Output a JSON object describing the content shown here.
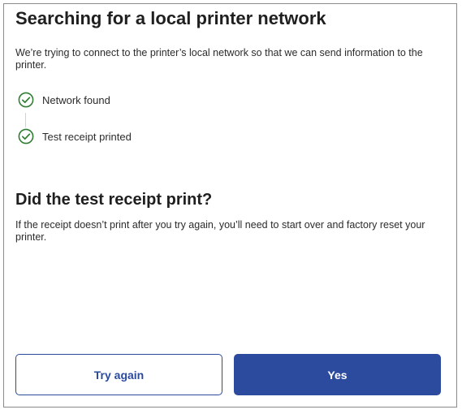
{
  "header": {
    "title": "Searching for a local printer network",
    "description": "We’re trying to connect to the printer’s local network so that we can send information to the printer."
  },
  "steps": [
    {
      "label": "Network found",
      "icon": "check-circle-icon",
      "status": "complete"
    },
    {
      "label": "Test receipt printed",
      "icon": "check-circle-icon",
      "status": "complete"
    }
  ],
  "question": {
    "title": "Did the test receipt print?",
    "description": "If the receipt doesn’t print after you try again, you’ll need to start over and factory reset your printer."
  },
  "actions": {
    "secondary_label": "Try again",
    "primary_label": "Yes"
  },
  "colors": {
    "accent": "#2c4a9e",
    "success": "#2e7d32"
  }
}
